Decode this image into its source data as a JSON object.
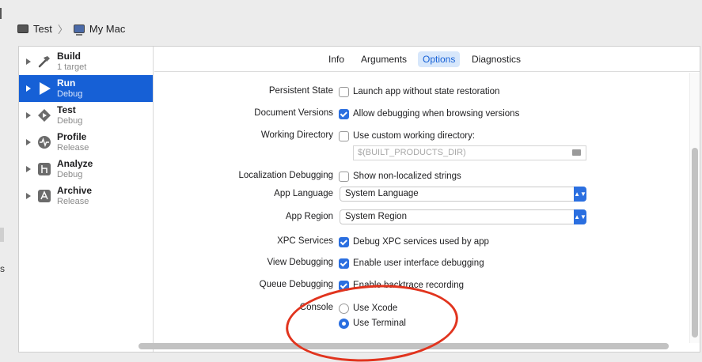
{
  "breadcrumb": {
    "scheme": "Test",
    "destination": "My Mac"
  },
  "left_edge_text": "s",
  "sidebar": {
    "items": [
      {
        "title": "Build",
        "subtitle": "1 target",
        "icon": "hammer-icon",
        "selected": false
      },
      {
        "title": "Run",
        "subtitle": "Debug",
        "icon": "play-icon",
        "selected": true
      },
      {
        "title": "Test",
        "subtitle": "Debug",
        "icon": "test-diamond-icon",
        "selected": false
      },
      {
        "title": "Profile",
        "subtitle": "Release",
        "icon": "waveform-icon",
        "selected": false
      },
      {
        "title": "Analyze",
        "subtitle": "Debug",
        "icon": "analyze-icon",
        "selected": false
      },
      {
        "title": "Archive",
        "subtitle": "Release",
        "icon": "archive-app-icon",
        "selected": false
      }
    ]
  },
  "tabs": [
    "Info",
    "Arguments",
    "Options",
    "Diagnostics"
  ],
  "active_tab": "Options",
  "options": {
    "persistent_state": {
      "label": "Persistent State",
      "text": "Launch app without state restoration",
      "checked": false
    },
    "document_versions": {
      "label": "Document Versions",
      "text": "Allow debugging when browsing versions",
      "checked": true
    },
    "working_directory": {
      "label": "Working Directory",
      "text": "Use custom working directory:",
      "checked": false,
      "path_placeholder": "$(BUILT_PRODUCTS_DIR)"
    },
    "localization_debugging": {
      "label": "Localization Debugging",
      "text": "Show non-localized strings",
      "checked": false
    },
    "app_language": {
      "label": "App Language",
      "value": "System Language"
    },
    "app_region": {
      "label": "App Region",
      "value": "System Region"
    },
    "xpc_services": {
      "label": "XPC Services",
      "text": "Debug XPC services used by app",
      "checked": true
    },
    "view_debugging": {
      "label": "View Debugging",
      "text": "Enable user interface debugging",
      "checked": true
    },
    "queue_debugging": {
      "label": "Queue Debugging",
      "text": "Enable backtrace recording",
      "checked": true
    },
    "console": {
      "label": "Console",
      "options": [
        "Use Xcode",
        "Use Terminal"
      ],
      "selected": "Use Terminal"
    }
  },
  "colors": {
    "accent": "#2b6fe0",
    "selection": "#1660d6",
    "annotation": "#e1341e"
  }
}
